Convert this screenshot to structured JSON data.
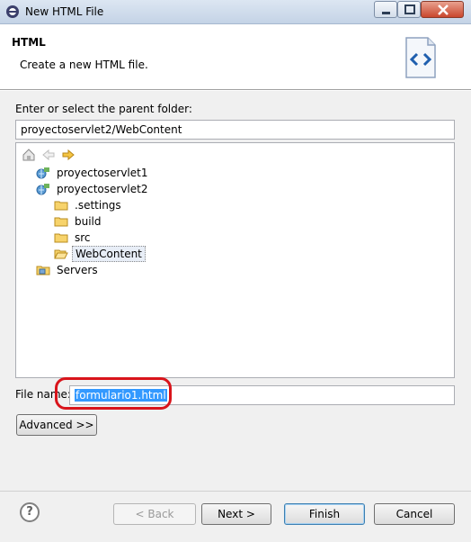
{
  "window": {
    "title": "New HTML File"
  },
  "banner": {
    "title": "HTML",
    "description": "Create a new HTML file.",
    "icon": "html-file-icon"
  },
  "parent_folder": {
    "label": "Enter or select the parent folder:",
    "value": "proyectoservlet2/WebContent"
  },
  "tree": {
    "toolbar": [
      "home-icon",
      "back-arrow-icon",
      "forward-arrow-icon"
    ],
    "items": [
      {
        "label": "proyectoservlet1",
        "icon": "web-project-icon",
        "selected": false
      },
      {
        "label": "proyectoservlet2",
        "icon": "web-project-icon",
        "selected": false
      },
      {
        "label": ".settings",
        "icon": "folder-icon",
        "selected": false
      },
      {
        "label": "build",
        "icon": "folder-icon",
        "selected": false
      },
      {
        "label": "src",
        "icon": "folder-icon",
        "selected": false
      },
      {
        "label": "WebContent",
        "icon": "open-folder-icon",
        "selected": true
      },
      {
        "label": "Servers",
        "icon": "servers-folder-icon",
        "selected": false
      }
    ]
  },
  "file_name": {
    "label": "File name:",
    "value": "formulario1.html"
  },
  "buttons": {
    "advanced": "Advanced >>",
    "back": "< Back",
    "next": "Next >",
    "finish": "Finish",
    "cancel": "Cancel",
    "help": "?"
  },
  "colors": {
    "selection": "#3399ff",
    "highlight_outline": "#d9141b"
  }
}
